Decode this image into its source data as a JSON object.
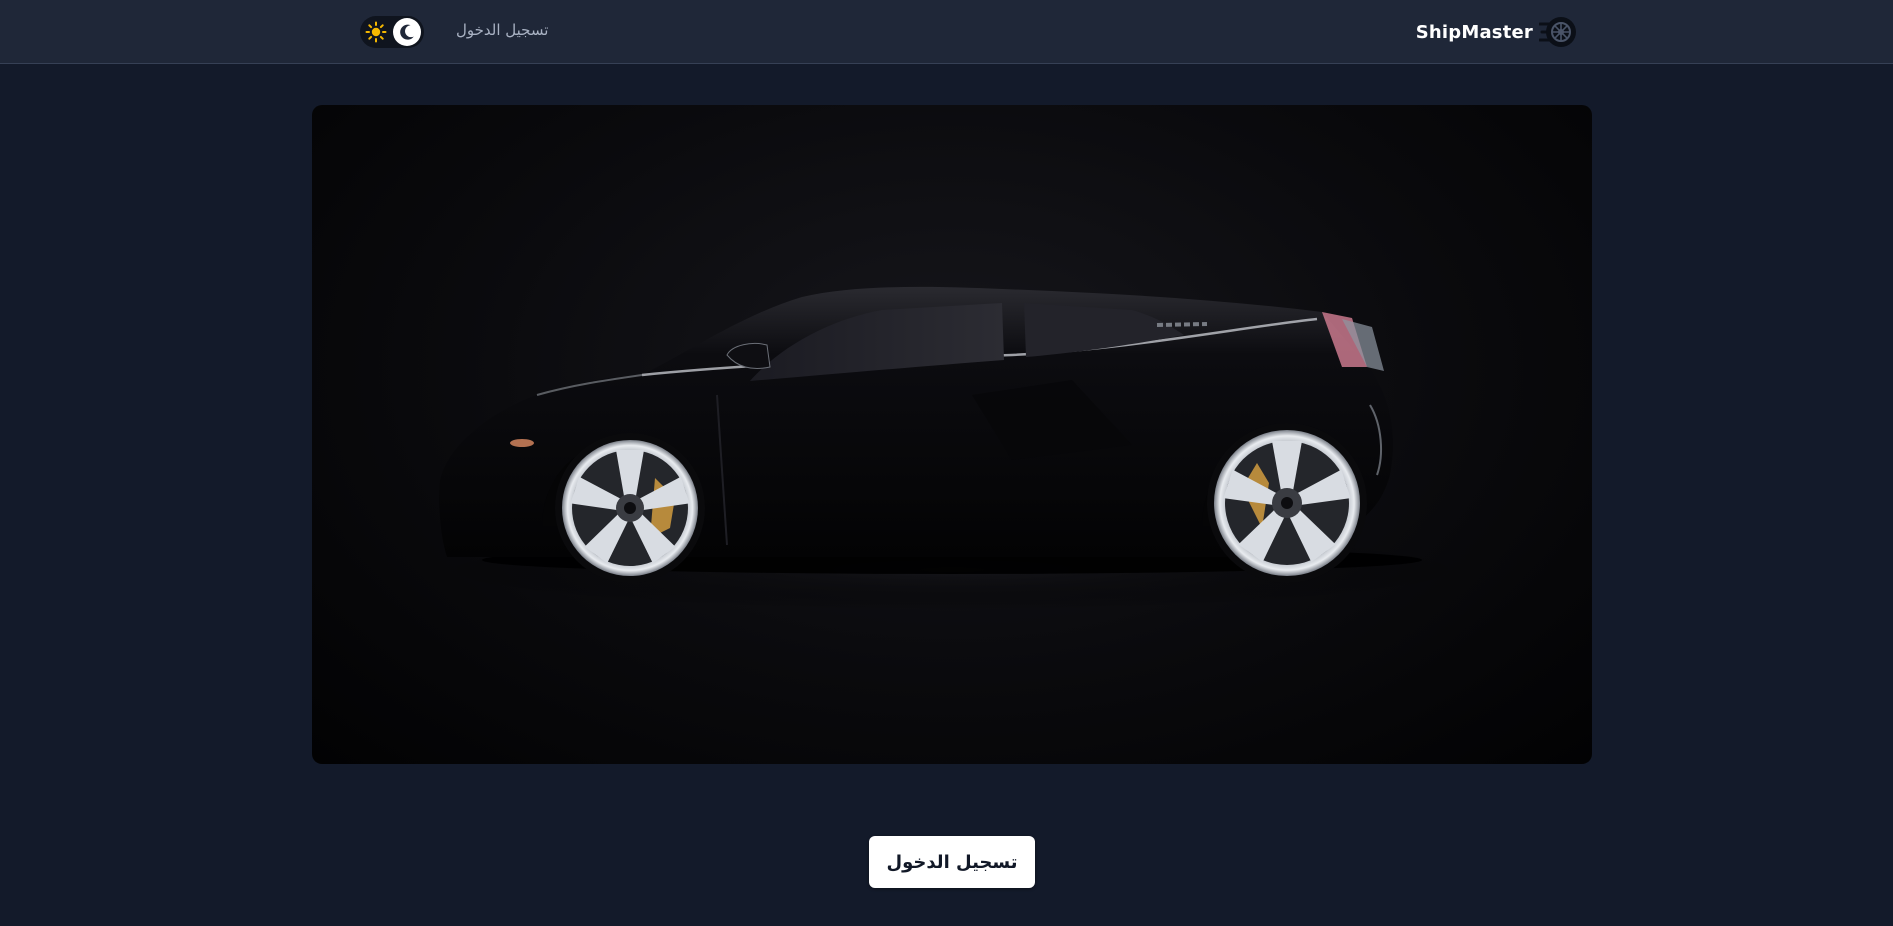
{
  "header": {
    "brand_name": "ShipMaster",
    "brand_icon": "tire-icon",
    "nav_login_label": "تسجيل الدخول",
    "theme_toggle": {
      "sun_icon": "sun-icon",
      "moon_icon": "moon-icon",
      "active_mode": "dark"
    }
  },
  "hero": {
    "image_subject": "black sports car"
  },
  "cta": {
    "login_label": "تسجيل الدخول"
  },
  "colors": {
    "page_background": "#131a2a",
    "header_background": "#1f2738",
    "sun_color": "#f5b800",
    "button_background": "#ffffff"
  }
}
